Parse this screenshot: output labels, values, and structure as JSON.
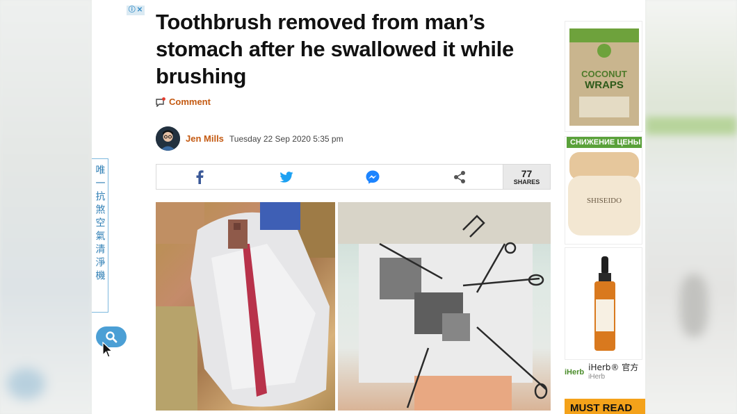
{
  "headline": "Toothbrush removed from man’s stomach after he swallowed it while brushing",
  "comment_label": "Comment",
  "author": {
    "name": "Jen Mills",
    "date": "Tuesday 22 Sep 2020 5:35 pm"
  },
  "share_bar": {
    "icons": [
      "facebook-icon",
      "twitter-icon",
      "messenger-icon",
      "share-icon"
    ],
    "count": "77",
    "count_label": "SHARES"
  },
  "ad_choices": {
    "icons": [
      "info-icon",
      "close-icon"
    ]
  },
  "left_banner": {
    "text": "唯一抗煞空氣清淨機"
  },
  "side_ads": {
    "ad1_text": [
      "COCONUT",
      "WRAPS"
    ],
    "ad2_tag": "СНИЖЕНИЕ ЦЕНЫ",
    "ad2_text": "SHISEIDO",
    "iherb_logo": "iHerb",
    "iherb_title": "iHerb® 官方",
    "iherb_sub": "iHerb"
  },
  "must_read": "MUST READ",
  "colors": {
    "accent": "#c45a12",
    "brand_blue": "#3b5998",
    "must_read": "#f4a21a"
  }
}
